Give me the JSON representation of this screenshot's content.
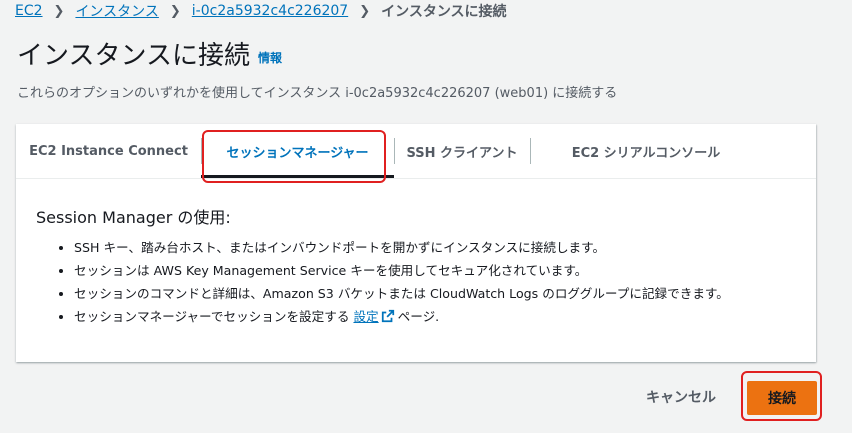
{
  "breadcrumb": {
    "items": [
      "EC2",
      "インスタンス",
      "i-0c2a5932c4c226207"
    ],
    "current": "インスタンスに接続"
  },
  "header": {
    "title": "インスタンスに接続",
    "info_link": "情報",
    "subtitle": "これらのオプションのいずれかを使用してインスタンス i-0c2a5932c4c226207 (web01) に接続する"
  },
  "tabs": [
    {
      "label": "EC2 Instance Connect",
      "active": false
    },
    {
      "label": "セッションマネージャー",
      "active": true
    },
    {
      "label": "SSH クライアント",
      "active": false
    },
    {
      "label": "EC2 シリアルコンソール",
      "active": false
    }
  ],
  "session_manager": {
    "heading": "Session Manager の使用:",
    "bullets": [
      "SSH キー、踏み台ホスト、またはインバウンドポートを開かずにインスタンスに接続します。",
      "セッションは AWS Key Management Service キーを使用してセキュア化されています。",
      "セッションのコマンドと詳細は、Amazon S3 バケットまたは CloudWatch Logs のロググループに記録できます。"
    ],
    "last_bullet_prefix": "セッションマネージャーでセッションを設定する",
    "last_bullet_link": "設定",
    "last_bullet_suffix": "ページ."
  },
  "actions": {
    "cancel_label": "キャンセル",
    "connect_label": "接続"
  },
  "colors": {
    "link": "#0073bb",
    "primary_button": "#ec7211",
    "highlight": "#e02020"
  },
  "icons": {
    "breadcrumb_separator": "chevron-right-icon",
    "external_link": "external-link-icon"
  }
}
